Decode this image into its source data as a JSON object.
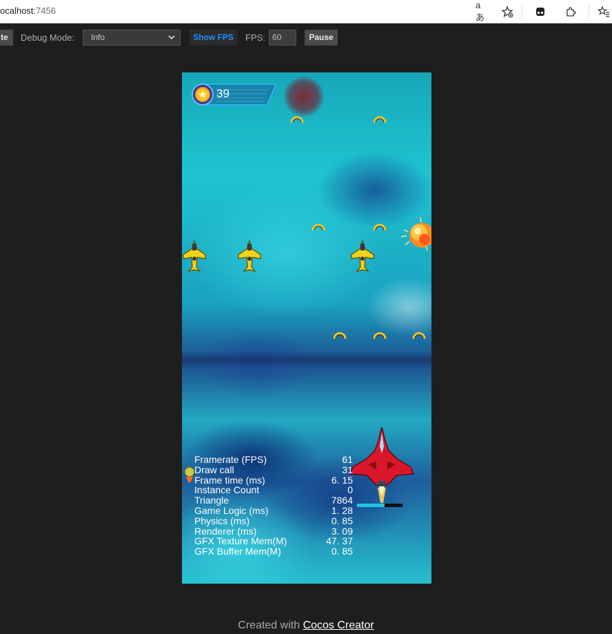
{
  "browser": {
    "url_host": "ocalhost",
    "url_port": ":7456",
    "read_aloud_icon": "aあ",
    "favorite_icon": "star-plus",
    "extensions": [
      "tab-icon",
      "puzzle-icon",
      "favorites-icon"
    ]
  },
  "toolbar": {
    "rotate_label": "te",
    "debug_mode_label": "Debug Mode:",
    "debug_mode_value": "Info",
    "show_fps_label": "Show FPS",
    "fps_label": "FPS:",
    "fps_value": "60",
    "pause_label": "Pause"
  },
  "game": {
    "score": "39",
    "stats": [
      {
        "label": "Framerate (FPS)",
        "value": "61"
      },
      {
        "label": "Draw call",
        "value": "31"
      },
      {
        "label": "Frame time (ms)",
        "value": "6. 15"
      },
      {
        "label": "Instance Count",
        "value": "0"
      },
      {
        "label": "Triangle",
        "value": "7864"
      },
      {
        "label": "Game Logic (ms)",
        "value": "1. 28"
      },
      {
        "label": "Physics (ms)",
        "value": "0. 85"
      },
      {
        "label": "Renderer (ms)",
        "value": "3. 09"
      },
      {
        "label": "GFX Texture Mem(M)",
        "value": "47. 37"
      },
      {
        "label": "GFX Buffer Mem(M)",
        "value": "0. 85"
      }
    ],
    "player_health_fraction": 0.6,
    "colors": {
      "player": "#d8182a",
      "enemy": "#f2d21a",
      "coin": "#f5c428",
      "hud_border": "#2fb8ff"
    }
  },
  "footer": {
    "prefix": "Created with",
    "link": "Cocos Creator"
  }
}
